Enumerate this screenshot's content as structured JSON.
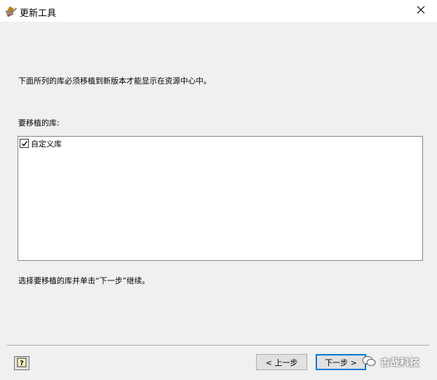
{
  "window": {
    "title": "更新工具",
    "app_icon": "update-tool-icon",
    "close_icon": "close-icon"
  },
  "content": {
    "intro": "下面所列的库必须移植到新版本才能显示在资源中心中。",
    "list_label": "要移植的库:",
    "libraries": [
      {
        "label": "自定义库",
        "checked": true
      }
    ],
    "hint": "选择要移植的库并单击“下一步”继续。"
  },
  "footer": {
    "help_icon": "help-icon",
    "back_label": "< 上一步",
    "next_label": "下一步 >"
  },
  "watermark": {
    "text": "古哉科技",
    "icon": "wechat-icon"
  },
  "colors": {
    "window_bg": "#f0f0f0",
    "titlebar_bg": "#ffffff",
    "focus_border": "#0078d7"
  }
}
